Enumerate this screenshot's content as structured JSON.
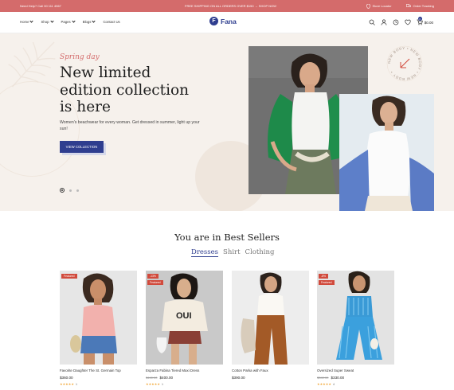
{
  "topbar": {
    "help": "Need Help? Call 00 111 4567",
    "promo": "FREE SHIPPING ON ALL ORDERS OVER $150  →  SHOP NOW",
    "store_locator": "Store Locator",
    "order_tracking": "Order Tracking",
    "bg_color": "#d46b6b"
  },
  "nav": {
    "items": [
      {
        "label": "Home",
        "has_dropdown": true
      },
      {
        "label": "Shop",
        "has_dropdown": true
      },
      {
        "label": "Pages",
        "has_dropdown": true
      },
      {
        "label": "Blogs",
        "has_dropdown": true
      },
      {
        "label": "Contact Us",
        "has_dropdown": false
      }
    ]
  },
  "logo": {
    "mark": "F",
    "text": "Fana",
    "color": "#2f3e8f"
  },
  "header_icons": [
    "search-icon",
    "user-icon",
    "history-icon",
    "heart-icon",
    "cart-icon"
  ],
  "cart": {
    "count": "0",
    "total": "$0.00"
  },
  "hero": {
    "kicker": "Spring day",
    "title": "New limited edition collection is here",
    "subtitle": "Women's beachwear for every woman. Get dressed in summer, light up your sun!",
    "cta": "VIEW COLLECTION",
    "badge_text": "NEW BODY • NEW BODY • NEW BODY •",
    "slides": 3,
    "active_slide": 1,
    "bg_color": "#f6f1ec"
  },
  "bestsellers": {
    "title": "You are in Best Sellers",
    "tabs": [
      {
        "label": "Dresses",
        "active": true
      },
      {
        "label": "Shirt",
        "active": false
      },
      {
        "label": "Clothing",
        "active": false
      }
    ],
    "products": [
      {
        "name": "Favorite Daughter The St. Germain Top",
        "price": "$360.00",
        "old_price": "",
        "tags": [
          "Featured"
        ],
        "stars": "★★★★★",
        "reviews": "1"
      },
      {
        "name": "Esparza Fabina Tiered Maxi Dress",
        "price": "$400.00",
        "old_price": "$440.00",
        "tags": [
          "-13%",
          "Featured"
        ],
        "stars": "★★★★★",
        "reviews": "1"
      },
      {
        "name": "Cotton Parka with Faux",
        "price": "$390.00",
        "old_price": "",
        "tags": [],
        "stars": "",
        "reviews": ""
      },
      {
        "name": "Oversized Super Sweat",
        "price": "$330.00",
        "old_price": "$340.00",
        "tags": [
          "-8%",
          "Featured"
        ],
        "stars": "★★★★★",
        "reviews": "4"
      }
    ]
  }
}
